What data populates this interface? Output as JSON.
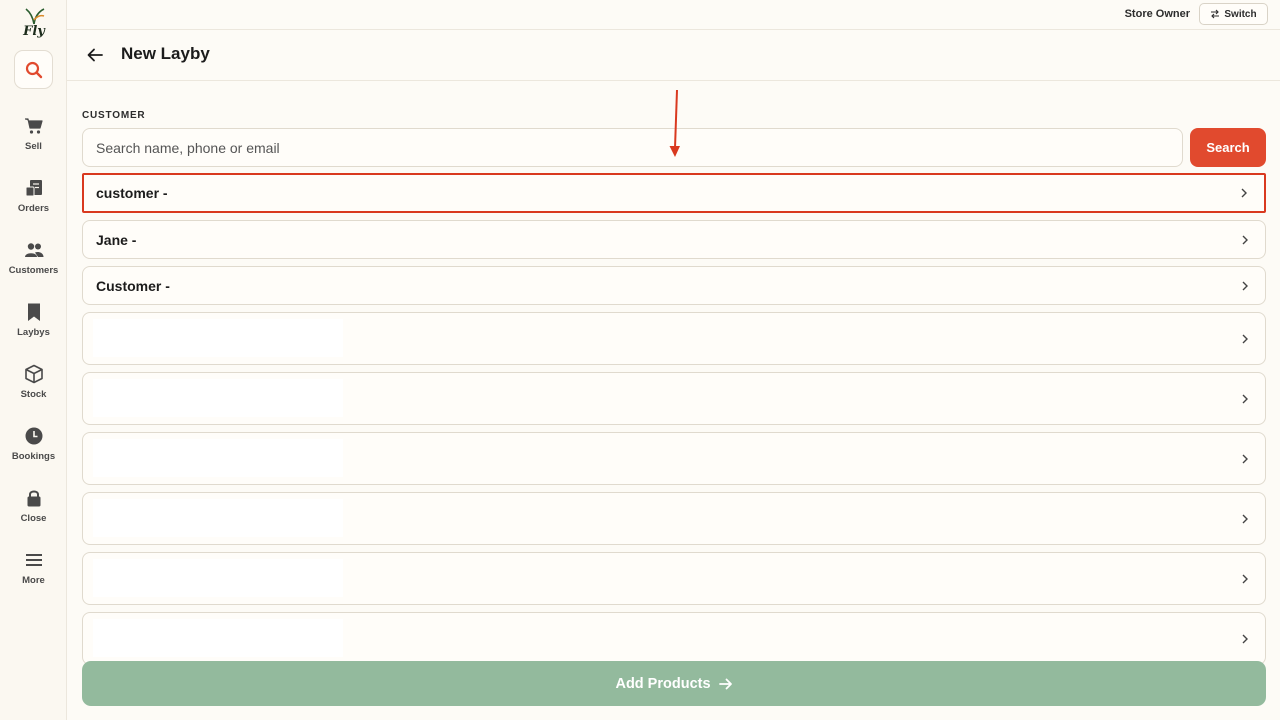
{
  "app": {
    "logo_text": "Fly"
  },
  "sidebar": {
    "items": [
      {
        "label": "Sell",
        "icon": "cart-icon"
      },
      {
        "label": "Orders",
        "icon": "receipt-icon"
      },
      {
        "label": "Customers",
        "icon": "users-icon"
      },
      {
        "label": "Laybys",
        "icon": "bookmark-icon"
      },
      {
        "label": "Stock",
        "icon": "box-icon"
      },
      {
        "label": "Bookings",
        "icon": "clock-icon"
      },
      {
        "label": "Close",
        "icon": "lock-icon"
      },
      {
        "label": "More",
        "icon": "menu-icon"
      }
    ]
  },
  "topbar": {
    "role": "Store Owner",
    "switch_label": "Switch"
  },
  "header": {
    "title": "New Layby"
  },
  "customer": {
    "section_label": "CUSTOMER",
    "search_placeholder": "Search name, phone or email",
    "search_value": "",
    "search_button": "Search",
    "results": [
      {
        "name": "customer -"
      },
      {
        "name": "Jane -"
      },
      {
        "name": "Customer -"
      }
    ]
  },
  "footer": {
    "add_products_label": "Add Products"
  },
  "colors": {
    "accent": "#e14a2e",
    "primary_disabled": "#93ba9d",
    "highlight_border": "#d9391f",
    "background": "#fdfbf6"
  }
}
